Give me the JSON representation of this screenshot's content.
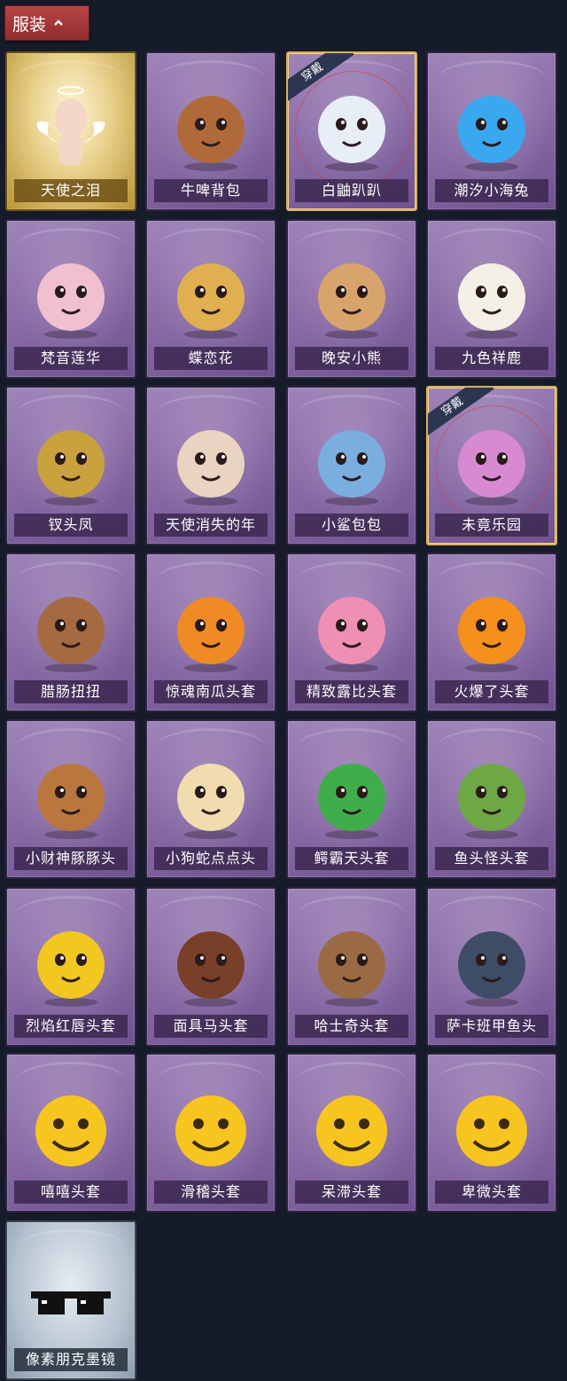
{
  "header": {
    "label": "服装"
  },
  "equipped_badge": "穿戴",
  "items": [
    {
      "name": "天使之泪",
      "rarity": "gold",
      "equipped": false,
      "icon": "angel-icon",
      "color": "#f3d6c8"
    },
    {
      "name": "牛啤背包",
      "rarity": "purple",
      "equipped": false,
      "icon": "cow-barrel-icon",
      "color": "#b06a3a"
    },
    {
      "name": "白鼬趴趴",
      "rarity": "purple",
      "equipped": true,
      "icon": "ermine-icon",
      "color": "#e8eef8"
    },
    {
      "name": "潮汐小海兔",
      "rarity": "purple",
      "equipped": false,
      "icon": "sea-bunny-icon",
      "color": "#3aa8ee"
    },
    {
      "name": "梵音莲华",
      "rarity": "purple",
      "equipped": false,
      "icon": "lotus-doll-icon",
      "color": "#f0c0d0"
    },
    {
      "name": "蝶恋花",
      "rarity": "purple",
      "equipped": false,
      "icon": "bell-wreath-icon",
      "color": "#e0b050"
    },
    {
      "name": "晚安小熊",
      "rarity": "purple",
      "equipped": false,
      "icon": "bear-charm-icon",
      "color": "#d9a36c"
    },
    {
      "name": "九色祥鹿",
      "rarity": "purple",
      "equipped": false,
      "icon": "deer-charm-icon",
      "color": "#f5f0e6"
    },
    {
      "name": "钗头凤",
      "rarity": "purple",
      "equipped": false,
      "icon": "phoenix-crown-icon",
      "color": "#c9a23e"
    },
    {
      "name": "天使消失的年",
      "rarity": "purple",
      "equipped": false,
      "icon": "angel-girl-icon",
      "color": "#e8d4c0"
    },
    {
      "name": "小鲨包包",
      "rarity": "purple",
      "equipped": false,
      "icon": "shark-bag-icon",
      "color": "#7aaede"
    },
    {
      "name": "未竟乐园",
      "rarity": "purple",
      "equipped": true,
      "icon": "fairy-doll-icon",
      "color": "#d78ad0"
    },
    {
      "name": "腊肠扭扭",
      "rarity": "purple",
      "equipped": false,
      "icon": "dachshund-head-icon",
      "color": "#a56a3f"
    },
    {
      "name": "惊魂南瓜头套",
      "rarity": "purple",
      "equipped": false,
      "icon": "pumpkin-head-icon",
      "color": "#f08a24"
    },
    {
      "name": "精致露比头套",
      "rarity": "purple",
      "equipped": false,
      "icon": "pink-beaver-head-icon",
      "color": "#f08fb4"
    },
    {
      "name": "火爆了头套",
      "rarity": "purple",
      "equipped": false,
      "icon": "flame-head-icon",
      "color": "#f5901e"
    },
    {
      "name": "小财神豚豚头",
      "rarity": "purple",
      "equipped": false,
      "icon": "capybara-head-icon",
      "color": "#b9773f"
    },
    {
      "name": "小狗蛇点点头",
      "rarity": "purple",
      "equipped": false,
      "icon": "snake-head-icon",
      "color": "#f1dcb0"
    },
    {
      "name": "鳄霸天头套",
      "rarity": "purple",
      "equipped": false,
      "icon": "crocodile-head-icon",
      "color": "#3fae4a"
    },
    {
      "name": "鱼头怪头套",
      "rarity": "purple",
      "equipped": false,
      "icon": "fish-monster-head-icon",
      "color": "#6da845"
    },
    {
      "name": "烈焰红唇头套",
      "rarity": "purple",
      "equipped": false,
      "icon": "yellow-mouse-head-icon",
      "color": "#f2c820"
    },
    {
      "name": "面具马头套",
      "rarity": "purple",
      "equipped": false,
      "icon": "horse-mask-icon",
      "color": "#7a3f28"
    },
    {
      "name": "哈士奇头套",
      "rarity": "purple",
      "equipped": false,
      "icon": "husky-head-icon",
      "color": "#9a6a42"
    },
    {
      "name": "萨卡班甲鱼头",
      "rarity": "purple",
      "equipped": false,
      "icon": "fish-head-icon",
      "color": "#3f4c68"
    },
    {
      "name": "嘻嘻头套",
      "rarity": "purple",
      "equipped": false,
      "icon": "grin-emoji-head-icon",
      "color": "#f7c520"
    },
    {
      "name": "滑稽头套",
      "rarity": "purple",
      "equipped": false,
      "icon": "funny-emoji-head-icon",
      "color": "#f7c520"
    },
    {
      "name": "呆滞头套",
      "rarity": "purple",
      "equipped": false,
      "icon": "dazed-emoji-head-icon",
      "color": "#f7c520"
    },
    {
      "name": "卑微头套",
      "rarity": "purple",
      "equipped": false,
      "icon": "humble-emoji-head-icon",
      "color": "#f7c520"
    },
    {
      "name": "像素朋克墨镜",
      "rarity": "silver",
      "equipped": false,
      "icon": "pixel-sunglasses-icon",
      "color": "#111111"
    }
  ]
}
